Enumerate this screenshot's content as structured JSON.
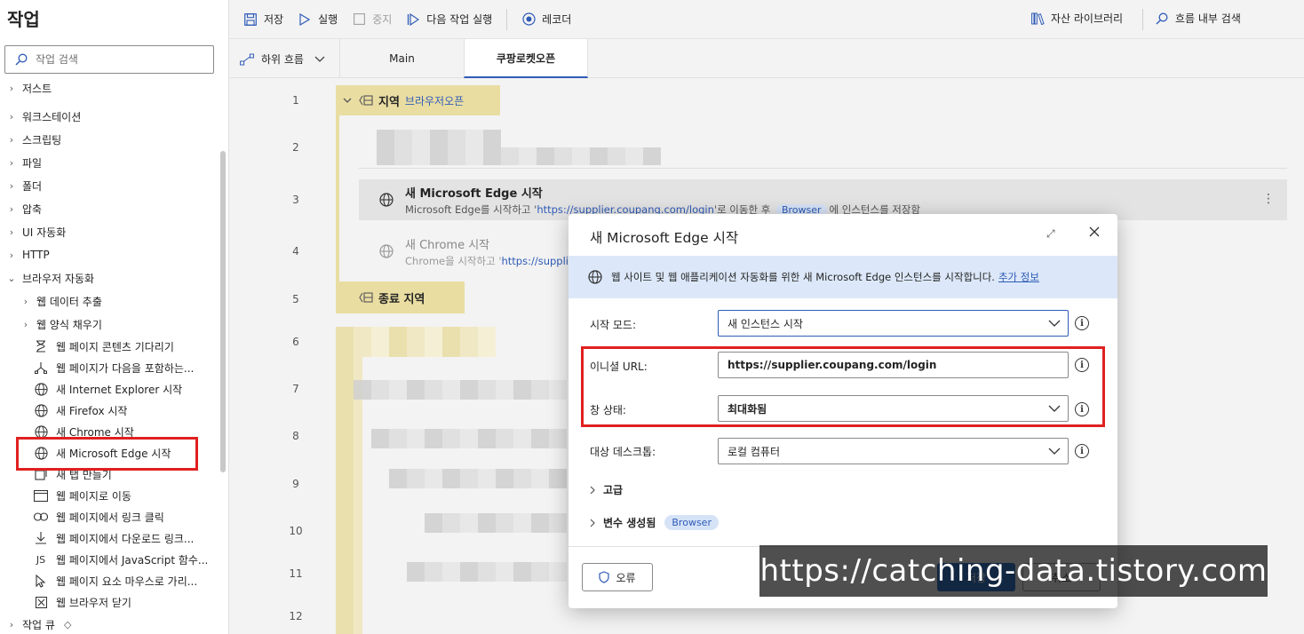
{
  "left_panel": {
    "title": "작업",
    "search_placeholder": "작업 검색",
    "categories": [
      {
        "label": "저스트",
        "expanded": false
      },
      {
        "label": "워크스테이션",
        "expanded": false
      },
      {
        "label": "스크립팅",
        "expanded": false
      },
      {
        "label": "파일",
        "expanded": false
      },
      {
        "label": "폴더",
        "expanded": false
      },
      {
        "label": "압축",
        "expanded": false
      },
      {
        "label": "UI 자동화",
        "expanded": false
      },
      {
        "label": "HTTP",
        "expanded": false
      },
      {
        "label": "브라우저 자동화",
        "expanded": true
      }
    ],
    "subcategories": [
      {
        "label": "웹 데이터 추출"
      },
      {
        "label": "웹 양식 채우기"
      }
    ],
    "actions": [
      {
        "label": "웹 페이지 콘텐츠 기다리기",
        "icon": "hourglass-icon"
      },
      {
        "label": "웹 페이지가 다음을 포함하는...",
        "icon": "branch-icon"
      },
      {
        "label": "새 Internet Explorer 시작",
        "icon": "globe-icon"
      },
      {
        "label": "새 Firefox 시작",
        "icon": "globe-icon"
      },
      {
        "label": "새 Chrome 시작",
        "icon": "globe-icon"
      },
      {
        "label": "새 Microsoft Edge 시작",
        "icon": "globe-icon"
      },
      {
        "label": "새 탭 만들기",
        "icon": "new-tab-icon"
      },
      {
        "label": "웹 페이지로 이동",
        "icon": "window-icon"
      },
      {
        "label": "웹 페이지에서 링크 클릭",
        "icon": "link-icon"
      },
      {
        "label": "웹 페이지에서 다운로드 링크...",
        "icon": "download-icon"
      },
      {
        "label": "웹 페이지에서 JavaScript 함수...",
        "icon": "js-icon"
      },
      {
        "label": "웹 페이지 요소 마우스로 가리...",
        "icon": "pointer-icon"
      },
      {
        "label": "웹 브라우저 닫기",
        "icon": "close-box-icon"
      }
    ],
    "queue_label": "작업 큐"
  },
  "toolbar": {
    "save": "저장",
    "run": "실행",
    "stop": "중지",
    "run_next": "다음 작업 실행",
    "recorder": "레코더",
    "asset_library": "자산 라이브러리",
    "search_flow": "흐름 내부 검색"
  },
  "tabs": {
    "subflows": "하위 흐름",
    "main": "Main",
    "active": "쿠팡로켓오픈"
  },
  "canvas": {
    "line_numbers": [
      "1",
      "2",
      "3",
      "4",
      "5",
      "6",
      "7",
      "8",
      "9",
      "10",
      "11",
      "12"
    ],
    "region_label": "지역",
    "region_name": "브라우저오픈",
    "end_region": "종료 지역",
    "edge_step": {
      "title": "새 Microsoft Edge 시작",
      "desc_prefix": "Microsoft Edge를 시작하고 '",
      "url": "https://supplier.coupang.com/login",
      "desc_mid": "'로 이동한 후 ",
      "var": "Browser",
      "desc_suffix": "에 인스턴스를 저장함"
    },
    "chrome_step": {
      "title": "새 Chrome 시작",
      "desc_prefix": "Chrome을 시작하고 '",
      "url": "https://suppli"
    }
  },
  "dialog": {
    "title": "새 Microsoft Edge 시작",
    "info_text": "웹 사이트 및 웹 애플리케이션 자동화를 위한 새 Microsoft Edge 인스턴스를 시작합니다.",
    "info_link": "추가 정보",
    "fields": {
      "launch_mode_label": "시작 모드:",
      "launch_mode_value": "새 인스턴스 시작",
      "initial_url_label": "이니셜 URL:",
      "initial_url_value": "https://supplier.coupang.com/login",
      "window_state_label": "창 상태:",
      "window_state_value": "최대화됨",
      "target_desktop_label": "대상 데스크톱:",
      "target_desktop_value": "로컬 컴퓨터"
    },
    "advanced_label": "고급",
    "variables_label": "변수 생성됨",
    "variable_chip": "Browser",
    "error_button": "오류",
    "save_button": "저장",
    "cancel_button": "취소"
  },
  "watermark": "https://catching-data.tistory.com",
  "colors": {
    "accent": "#2f5bb7",
    "region": "#e9dda2",
    "highlight": "#e02020",
    "primary_button": "#0f5fc8"
  }
}
